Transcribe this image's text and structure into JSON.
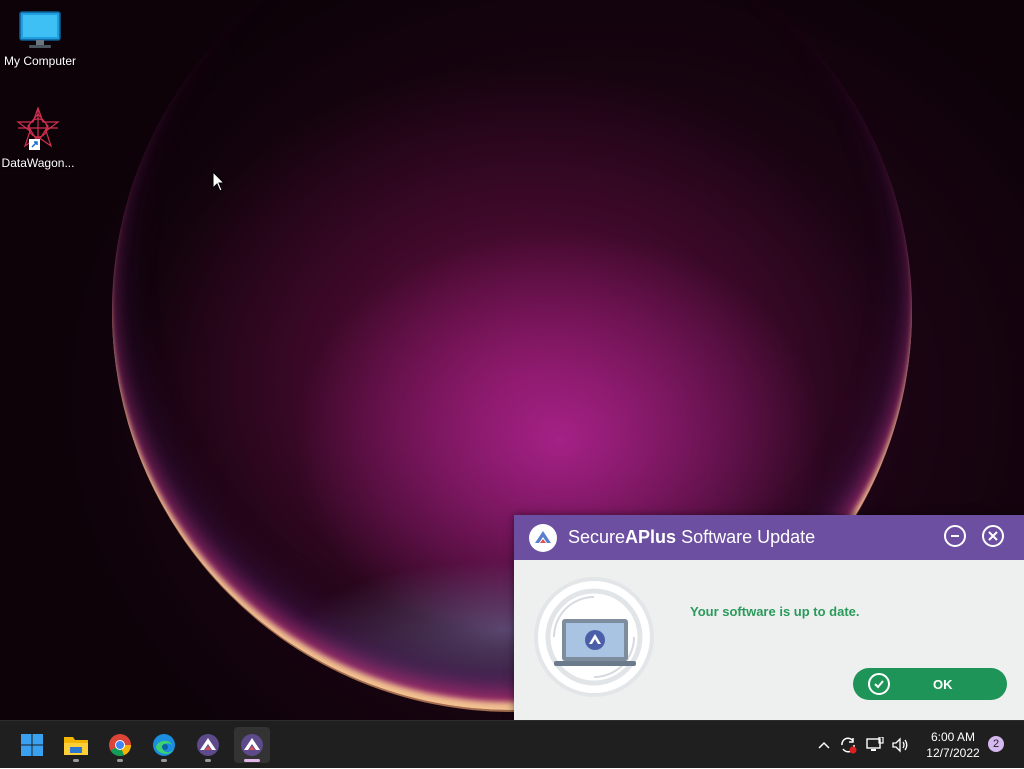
{
  "desktop": {
    "icons": [
      {
        "label": "My Computer"
      },
      {
        "label": "DataWagon..."
      }
    ]
  },
  "dialog": {
    "title_prefix": "Secure",
    "title_bold": "APlus",
    "title_suffix": " Software Update",
    "message": "Your software is up to date.",
    "ok_label": "OK",
    "title_bar_color": "#6d4fa1",
    "accent_color": "#1e9458"
  },
  "taskbar": {
    "apps": [
      {
        "icon": "windows-start-icon"
      },
      {
        "icon": "file-explorer-icon"
      },
      {
        "icon": "chrome-icon"
      },
      {
        "icon": "edge-icon"
      },
      {
        "icon": "secureaplus-icon"
      },
      {
        "icon": "secureaplus-update-icon",
        "active": true
      }
    ],
    "tray": {
      "time": "6:00 AM",
      "date": "12/7/2022",
      "notification_count": "2"
    }
  }
}
